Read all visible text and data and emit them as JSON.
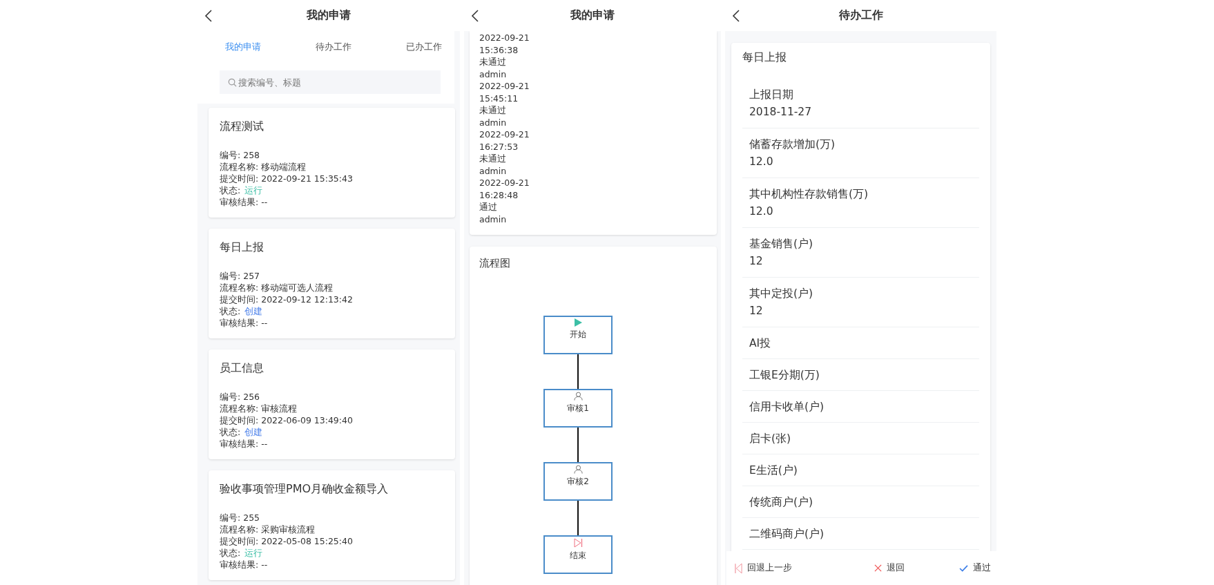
{
  "panels_left": {
    "header": {
      "title": "我的申请"
    },
    "tabs": [
      {
        "label": "我的申请",
        "selected": true
      },
      {
        "label": "待办工作",
        "selected": false
      },
      {
        "label": "已办工作",
        "selected": false
      }
    ],
    "search": {
      "placeholder": "搜索编号、标题"
    },
    "cards": [
      {
        "title": "流程测试",
        "number": "编号: 258",
        "process": "流程名称: 移动端流程",
        "submitted": "提交时间: 2022-09-21 15:35:43",
        "status_label": "状态:",
        "status": "运行",
        "color": "#3cbfa6",
        "result": "审核结果:  --"
      },
      {
        "title": "每日上报",
        "number": "编号: 257",
        "process": "流程名称: 移动端可选人流程",
        "submitted": "提交时间: 2022-09-12 12:13:42",
        "status_label": "状态:",
        "status": "创建",
        "color": "#4b80ea",
        "result": "审核结果:  --"
      },
      {
        "title": "员工信息",
        "number": "编号: 256",
        "process": "流程名称: 审核流程",
        "submitted": "提交时间: 2022-06-09 13:49:40",
        "status_label": "状态:",
        "status": "创建",
        "color": "#4b80ea",
        "result": "审核结果:  --"
      },
      {
        "title": "验收事项管理PMO月确收金额导入",
        "number": "编号: 255",
        "process": "流程名称: 采购审核流程",
        "submitted": "提交时间: 2022-05-08 15:25:40",
        "status_label": "状态:",
        "status": "运行",
        "color": "#3cbfa6",
        "result": "审核结果:  --"
      }
    ]
  },
  "panel_middle": {
    "header": {
      "title": "我的申请"
    },
    "log": [
      {
        "date": "2022-09-21",
        "time": "15:36:38",
        "result": "未通过",
        "user": "admin"
      },
      {
        "date": "2022-09-21",
        "time": "15:45:11",
        "result": "未通过",
        "user": "admin"
      },
      {
        "date": "2022-09-21",
        "time": "16:27:53",
        "result": "未通过",
        "user": "admin"
      },
      {
        "date": "2022-09-21",
        "time": "16:28:48",
        "result": "通过",
        "user": "admin"
      }
    ],
    "flow": {
      "title": "流程图",
      "nodes": [
        {
          "kind": "start",
          "label": "开始"
        },
        {
          "kind": "task",
          "label": "审核1"
        },
        {
          "kind": "task",
          "label": "审核2"
        },
        {
          "kind": "end",
          "label": "结束"
        }
      ]
    }
  },
  "panel_right": {
    "header": {
      "title": "待办工作"
    },
    "form": {
      "title": "每日上报",
      "fields": [
        {
          "label": "上报日期",
          "value": "2018-11-27"
        },
        {
          "label": "储蓄存款增加(万)",
          "value": "12.0"
        },
        {
          "label": "其中机构性存款销售(万)",
          "value": "12.0"
        },
        {
          "label": "基金销售(户)",
          "value": "12"
        },
        {
          "label": "其中定投(户)",
          "value": "12"
        },
        {
          "label": "AI投"
        },
        {
          "label": "工银E分期(万)"
        },
        {
          "label": "信用卡收单(户)"
        },
        {
          "label": "启卡(张)"
        },
        {
          "label": "E生活(户)"
        },
        {
          "label": "传统商户(户)"
        },
        {
          "label": "二维码商户(户)"
        }
      ]
    },
    "actions": [
      {
        "kind": "back",
        "label": "回退上一步"
      },
      {
        "kind": "reject",
        "label": "退回"
      },
      {
        "kind": "approve",
        "label": "通过"
      }
    ]
  }
}
